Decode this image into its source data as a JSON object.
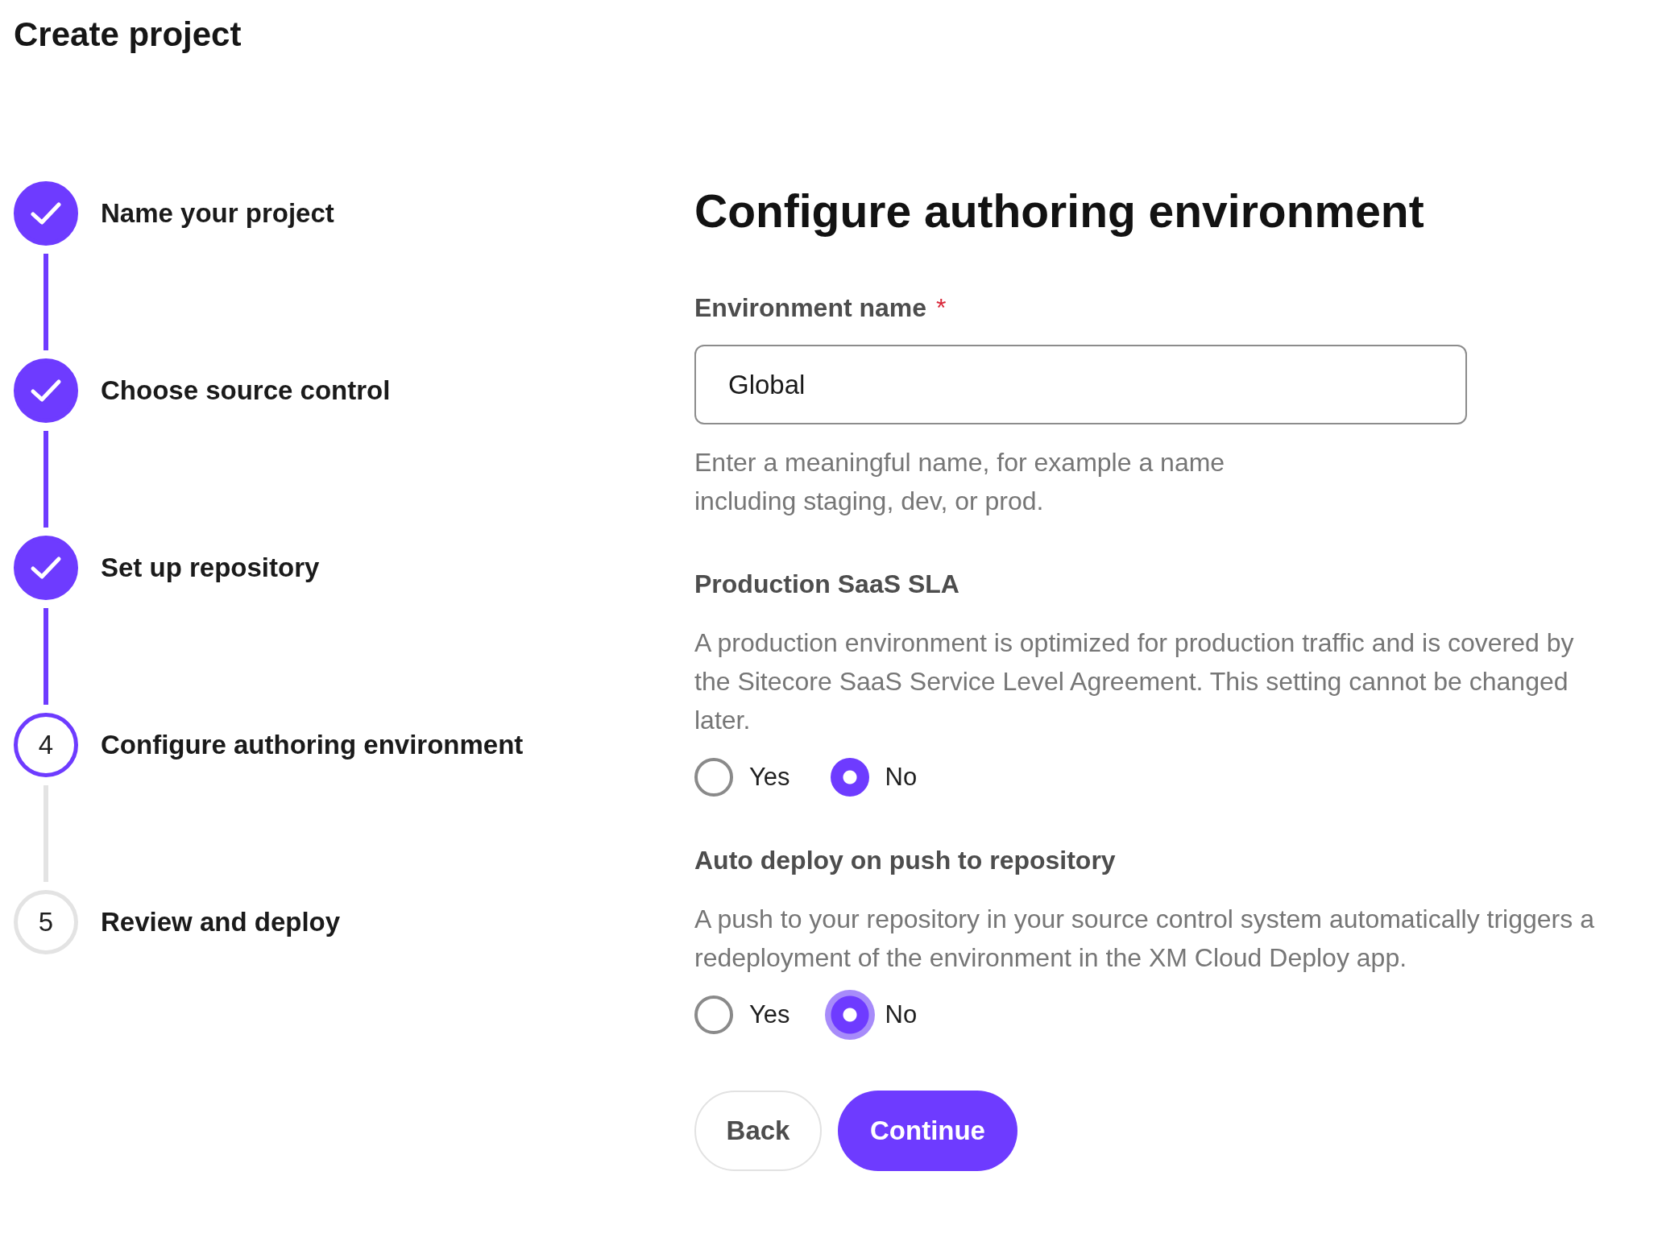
{
  "page": {
    "title": "Create project"
  },
  "stepper": {
    "steps": [
      {
        "completed": true,
        "current": false,
        "label": "Name your project"
      },
      {
        "completed": true,
        "current": false,
        "label": "Choose source control"
      },
      {
        "completed": true,
        "current": false,
        "label": "Set up repository"
      },
      {
        "completed": false,
        "current": true,
        "number": "4",
        "label": "Configure authoring environment"
      },
      {
        "completed": false,
        "current": false,
        "number": "5",
        "label": "Review and deploy"
      }
    ]
  },
  "form": {
    "heading": "Configure authoring environment",
    "fields": [
      {
        "kind": "text",
        "label": "Environment name",
        "required_mark": "*",
        "value": "Global",
        "help": "Enter a meaningful name, for example a name including staging, dev, or prod."
      },
      {
        "kind": "radio",
        "label": "Production SaaS SLA",
        "description": "A production environment is optimized for production traffic and is covered by the Sitecore SaaS Service Level Agreement. This setting cannot be changed later.",
        "options": [
          {
            "label": "Yes",
            "selected": false,
            "focused": false
          },
          {
            "label": "No",
            "selected": true,
            "focused": false
          }
        ]
      },
      {
        "kind": "radio",
        "label": "Auto deploy on push to repository",
        "description": "A push to your repository in your source control system automatically triggers a redeployment of the environment in the XM Cloud Deploy app.",
        "options": [
          {
            "label": "Yes",
            "selected": false,
            "focused": false
          },
          {
            "label": "No",
            "selected": true,
            "focused": true
          }
        ]
      }
    ],
    "buttons": [
      {
        "kind": "secondary",
        "label": "Back"
      },
      {
        "kind": "primary",
        "label": "Continue"
      }
    ]
  }
}
